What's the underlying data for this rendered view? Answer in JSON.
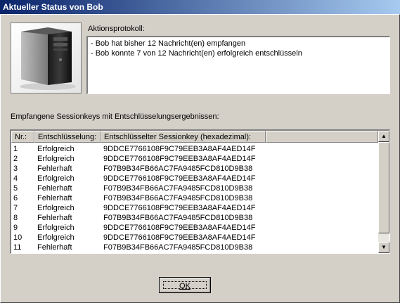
{
  "window": {
    "title": "Aktueller Status von Bob"
  },
  "log": {
    "label": "Aktionsprotokoll:",
    "lines": [
      "- Bob hat bisher 12 Nachricht(en) empfangen",
      "- Bob konnte 7 von 12 Nachricht(en) erfolgreich entschlüsseln"
    ]
  },
  "keys": {
    "label": "Empfangene Sessionkeys mit Entschlüsselungsergebnissen:",
    "columns": [
      "Nr.:",
      "Entschlüsselung:",
      "Entschlüsselter Sessionkey (hexadezimal):"
    ],
    "rows": [
      [
        "1",
        "Erfolgreich",
        "9DDCE7766108F9C79EEB3A8AF4AED14F"
      ],
      [
        "2",
        "Erfolgreich",
        "9DDCE7766108F9C79EEB3A8AF4AED14F"
      ],
      [
        "3",
        "Fehlerhaft",
        "F07B9B34FB66AC7FA9485FCD810D9B38"
      ],
      [
        "4",
        "Erfolgreich",
        "9DDCE7766108F9C79EEB3A8AF4AED14F"
      ],
      [
        "5",
        "Fehlerhaft",
        "F07B9B34FB66AC7FA9485FCD810D9B38"
      ],
      [
        "6",
        "Fehlerhaft",
        "F07B9B34FB66AC7FA9485FCD810D9B38"
      ],
      [
        "7",
        "Erfolgreich",
        "9DDCE7766108F9C79EEB3A8AF4AED14F"
      ],
      [
        "8",
        "Fehlerhaft",
        "F07B9B34FB66AC7FA9485FCD810D9B38"
      ],
      [
        "9",
        "Erfolgreich",
        "9DDCE7766108F9C79EEB3A8AF4AED14F"
      ],
      [
        "10",
        "Erfolgreich",
        "9DDCE7766108F9C79EEB3A8AF4AED14F"
      ],
      [
        "11",
        "Fehlerhaft",
        "F07B9B34FB66AC7FA9485FCD810D9B38"
      ]
    ]
  },
  "scrollbar": {
    "up_icon": "arrow-up-icon",
    "down_icon": "arrow-down-icon"
  },
  "buttons": {
    "ok_label": "OK"
  },
  "icons": {
    "computer": "computer-tower-icon"
  }
}
